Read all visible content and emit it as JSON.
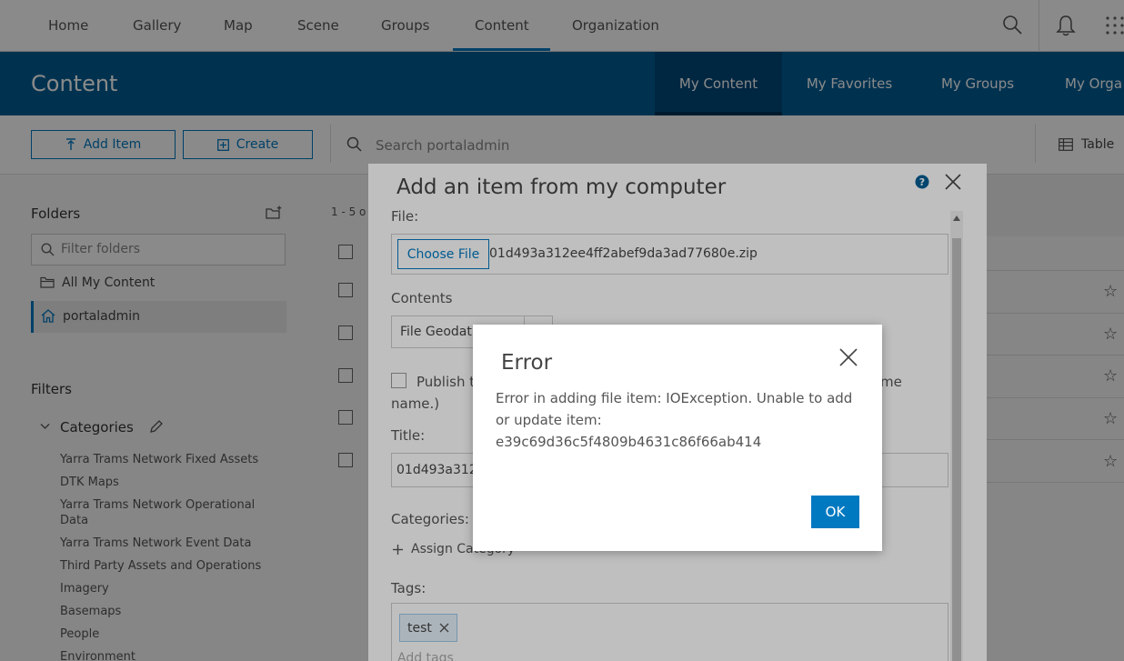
{
  "topnav": {
    "items": [
      "Home",
      "Gallery",
      "Map",
      "Scene",
      "Groups",
      "Content",
      "Organization"
    ],
    "active": "Content",
    "icons": [
      "search-icon",
      "bell-icon",
      "apps-grid-icon"
    ]
  },
  "header": {
    "title": "Content",
    "tabs": [
      "My Content",
      "My Favorites",
      "My Groups",
      "My Orga"
    ],
    "active_tab": "My Content"
  },
  "toolbar": {
    "add_item": "Add Item",
    "create": "Create",
    "search_placeholder": "Search portaladmin",
    "view_label": "Table"
  },
  "sidebar": {
    "folders_heading": "Folders",
    "filter_placeholder": "Filter folders",
    "folders": [
      "All My Content",
      "portaladmin"
    ],
    "selected_folder": "portaladmin",
    "filters_heading": "Filters",
    "categories_heading": "Categories",
    "categories": [
      "Yarra Trams Network Fixed Assets",
      "DTK Maps",
      "Yarra Trams Network Operational Data",
      "Yarra Trams Network Event Data",
      "Third Party Assets and Operations",
      "Imagery",
      "Basemaps",
      "People",
      "Environment"
    ]
  },
  "list": {
    "count_text": "1 - 5 o"
  },
  "panel": {
    "title": "Add an item from my computer",
    "file_label": "File:",
    "choose_file": "Choose File",
    "file_name": "01d493a312ee4ff2abef9da3ad77680e.zip",
    "contents_label": "Contents",
    "contents_value": "File Geodat",
    "publish_text": "Publish t",
    "publish_tail": "me",
    "publish_line2": "name.)",
    "title_label": "Title:",
    "title_value": "01d493a312",
    "categories_label": "Categories:",
    "assign_category": "Assign Category",
    "tags_label": "Tags:",
    "tag": "test",
    "tags_placeholder": "Add tags"
  },
  "dialog": {
    "title": "Error",
    "message": "Error in adding file item: IOException. Unable to add or update item: e39c69d36c5f4809b4631c86f66ab414",
    "ok": "OK"
  },
  "colors": {
    "brand_blue": "#0079c1",
    "header_blue": "#005e95"
  }
}
